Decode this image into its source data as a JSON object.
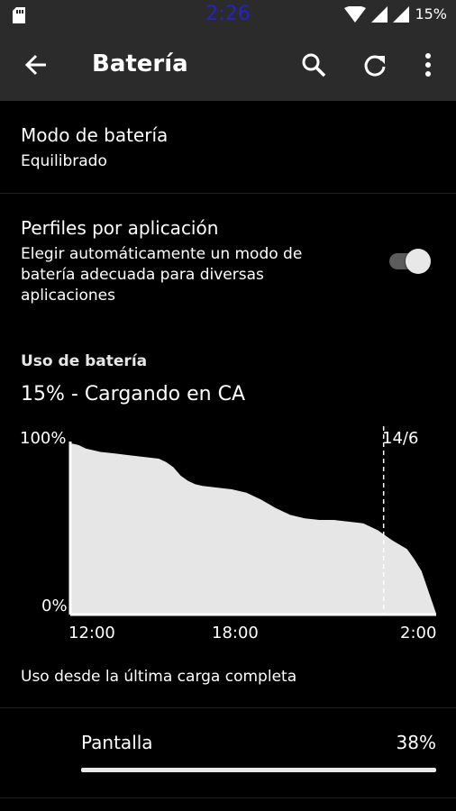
{
  "status_bar": {
    "time": "2:26",
    "battery_percent": "15%"
  },
  "app_bar": {
    "title": "Batería",
    "back_icon": "arrow-back-icon",
    "search_icon": "search-icon",
    "refresh_icon": "refresh-icon",
    "more_icon": "more-vert-icon"
  },
  "battery_mode": {
    "title": "Modo de batería",
    "value": "Equilibrado"
  },
  "app_profiles": {
    "title": "Perfiles por aplicación",
    "description_lines": [
      "Elegir automáticamente un modo de",
      "batería adecuada para diversas",
      "aplicaciones"
    ],
    "enabled": true
  },
  "usage": {
    "section_title": "Uso de batería",
    "status": "15% - Cargando en CA",
    "since_label": "Uso desde la última carga completa"
  },
  "chart_data": {
    "type": "area",
    "y_tick_labels": [
      "100%",
      "0%"
    ],
    "x_tick_labels": [
      "12:00",
      "18:00",
      "2:00"
    ],
    "marker_label": "14/6",
    "ylim": [
      0,
      100
    ],
    "points": [
      [
        0,
        100
      ],
      [
        0.5,
        99
      ],
      [
        1,
        97
      ],
      [
        2,
        95
      ],
      [
        3,
        94
      ],
      [
        4,
        93
      ],
      [
        5,
        92
      ],
      [
        6,
        91
      ],
      [
        6.5,
        89
      ],
      [
        7,
        86
      ],
      [
        7.5,
        81
      ],
      [
        8,
        78
      ],
      [
        8.5,
        76
      ],
      [
        9,
        75
      ],
      [
        10,
        74
      ],
      [
        11,
        73
      ],
      [
        12,
        71
      ],
      [
        13,
        67
      ],
      [
        14,
        62
      ],
      [
        15,
        58
      ],
      [
        16,
        56
      ],
      [
        17,
        55
      ],
      [
        18,
        55
      ],
      [
        19,
        54
      ],
      [
        20,
        53
      ],
      [
        21,
        49
      ],
      [
        22,
        43
      ],
      [
        23,
        38
      ],
      [
        23.5,
        32
      ],
      [
        24,
        25
      ],
      [
        25,
        0
      ]
    ],
    "marker_x": 21.4,
    "color": "#e6e6e6"
  },
  "usage_items": [
    {
      "label": "Pantalla",
      "value": "38%",
      "fraction": 0.38
    }
  ]
}
